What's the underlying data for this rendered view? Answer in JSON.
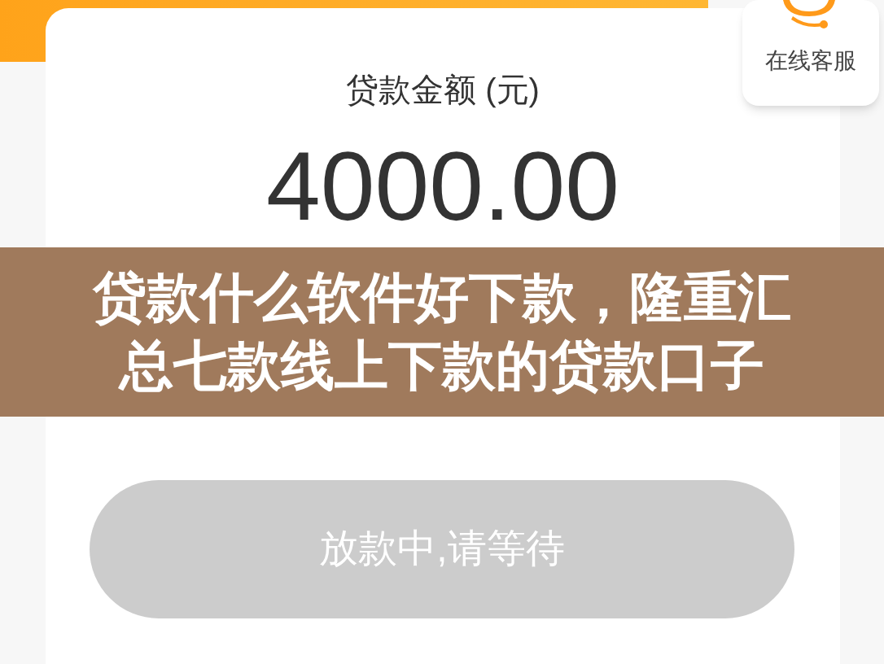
{
  "amount_label": "贷款金额 (元)",
  "amount": "4000.00",
  "support": {
    "label": "在线客服"
  },
  "submit_button": {
    "label": "放款中,请等待",
    "disabled": true
  },
  "banner": {
    "lines": [
      "贷款什么软件好下款，隆重汇",
      "总七款线上下款的贷款口子"
    ]
  }
}
